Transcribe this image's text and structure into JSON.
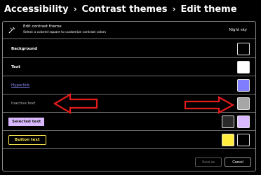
{
  "breadcrumb": {
    "items": [
      "Accessibility",
      "Contrast themes",
      "Edit theme"
    ],
    "separator": "›"
  },
  "header": {
    "icon": "paint-brush-icon",
    "title": "Edit contrast theme",
    "subtitle": "Select a colored square to customize contrast colors",
    "theme_name": "Night sky"
  },
  "rows": [
    {
      "label": "Background",
      "swatches": [
        "#000000"
      ]
    },
    {
      "label": "Text",
      "swatches": [
        "#ffffff"
      ]
    },
    {
      "label": "Hyperlink",
      "swatches": [
        "#807eff"
      ]
    },
    {
      "label": "Inactive text",
      "swatches": [
        "#a6a6a6"
      ]
    },
    {
      "label": "Selected text",
      "swatches": [
        "#2a2a2a",
        "#d9b8ff"
      ]
    },
    {
      "label": "Button text",
      "swatches": [
        "#ffec3d",
        "#000000"
      ]
    }
  ],
  "footer": {
    "save_label": "Save as",
    "cancel_label": "Cancel"
  },
  "annotation": {
    "arrow_color": "#e41b1b"
  }
}
